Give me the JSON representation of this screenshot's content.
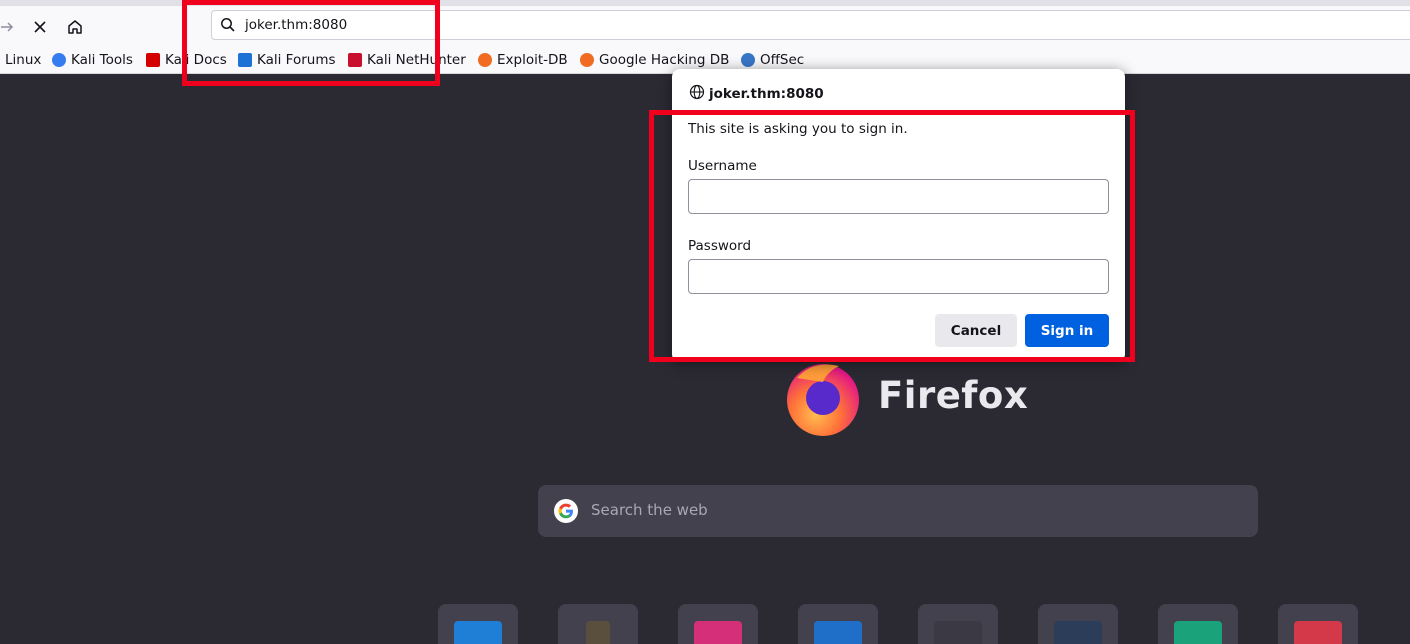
{
  "toolbar": {
    "forward_icon": "arrow-right-icon",
    "stop_icon": "close-icon",
    "home_icon": "home-icon",
    "url": "joker.thm:8080"
  },
  "bookmarks": [
    {
      "label": "Linux",
      "color": "#ffffff"
    },
    {
      "label": "Kali Tools",
      "color": "#367bf0"
    },
    {
      "label": "Kali Docs",
      "color": "#d40000"
    },
    {
      "label": "Kali Forums",
      "color": "#1e72d6"
    },
    {
      "label": "Kali NetHunter",
      "color": "#c8102e"
    },
    {
      "label": "Exploit-DB",
      "color": "#ef6c22"
    },
    {
      "label": "Google Hacking DB",
      "color": "#ef6c22"
    },
    {
      "label": "OffSec",
      "color": "#3877c8"
    }
  ],
  "dialog": {
    "host": "joker.thm:8080",
    "message": "This site is asking you to sign in.",
    "username_label": "Username",
    "username_value": "",
    "password_label": "Password",
    "password_value": "",
    "cancel_label": "Cancel",
    "signin_label": "Sign in"
  },
  "newtab": {
    "brand": "Firefox",
    "search_placeholder": "Search the web",
    "tiles": [
      {
        "name": "tile-1",
        "color": "#1f7fd6"
      },
      {
        "name": "tile-2",
        "color": "#5a4f3c"
      },
      {
        "name": "tile-3",
        "color": "#d62f7a"
      },
      {
        "name": "tile-4",
        "color": "#1f6fc8"
      },
      {
        "name": "tile-5",
        "color": "#3b3a44"
      },
      {
        "name": "tile-6",
        "color": "#2c3d5a"
      },
      {
        "name": "tile-7",
        "color": "#1aa37a"
      },
      {
        "name": "tile-8",
        "color": "#d4394a"
      }
    ]
  },
  "colors": {
    "annotation": "#f0001c",
    "accent": "#0061e0",
    "page_background": "#2b2a33"
  }
}
